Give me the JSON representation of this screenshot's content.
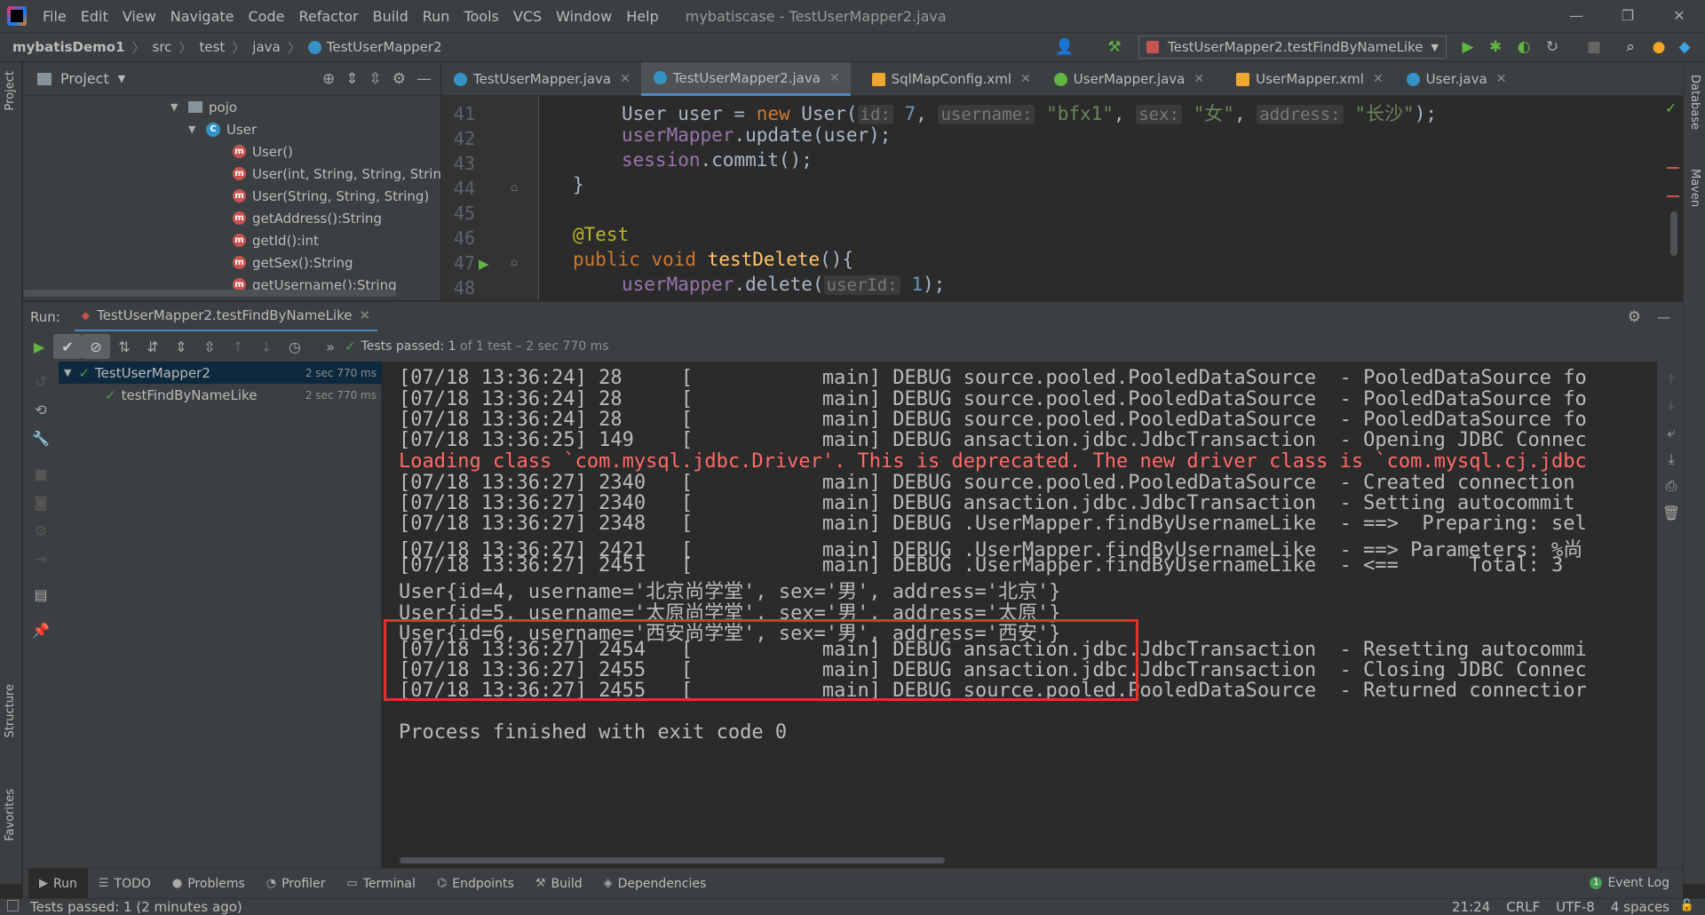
{
  "menubar": {
    "items": [
      "File",
      "Edit",
      "View",
      "Navigate",
      "Code",
      "Refactor",
      "Build",
      "Run",
      "Tools",
      "VCS",
      "Window",
      "Help"
    ],
    "window_title": "mybatiscase - TestUserMapper2.java",
    "minimize": "—",
    "maximize": "❐",
    "close": "✕"
  },
  "navbar": {
    "project": "mybatisDemo1",
    "crumbs": [
      "src",
      "test",
      "java"
    ],
    "file": "TestUserMapper2",
    "run_config": "TestUserMapper2.testFindByNameLike"
  },
  "project_panel": {
    "title": "Project",
    "tree": [
      {
        "label": "pojo",
        "kind": "package"
      },
      {
        "label": "User",
        "kind": "class"
      },
      {
        "label": "User()",
        "kind": "method"
      },
      {
        "label": "User(int, String, String, String",
        "kind": "method"
      },
      {
        "label": "User(String, String, String)",
        "kind": "method"
      },
      {
        "label": "getAddress():String",
        "kind": "method"
      },
      {
        "label": "getId():int",
        "kind": "method"
      },
      {
        "label": "getSex():String",
        "kind": "method"
      },
      {
        "label": "getUsername():String",
        "kind": "method"
      }
    ]
  },
  "tabs": [
    {
      "label": "TestUserMapper.java",
      "icon": "class"
    },
    {
      "label": "TestUserMapper2.java",
      "icon": "class"
    },
    {
      "label": "SqlMapConfig.xml",
      "icon": "xml"
    },
    {
      "label": "UserMapper.java",
      "icon": "interface"
    },
    {
      "label": "UserMapper.xml",
      "icon": "xml"
    },
    {
      "label": "User.java",
      "icon": "class"
    }
  ],
  "editor": {
    "line_numbers": [
      "41",
      "42",
      "43",
      "44",
      "45",
      "46",
      "47",
      "48"
    ],
    "line41": {
      "a": "User user = ",
      "kw": "new",
      "b": " User(",
      "h1": "id:",
      "n1": "7",
      "h2": "username:",
      "s1": "\"bfx1\"",
      "h3": "sex:",
      "s2": "\"女\"",
      "h4": "address:",
      "s3": "\"长沙\"",
      "end": ");"
    },
    "line42": {
      "f": "userMapper",
      "m": ".update(user);"
    },
    "line43": {
      "f": "session",
      "m": ".commit();"
    },
    "line44": "}",
    "line46": "@Test",
    "line47": {
      "kw": "public void ",
      "fn": "testDelete",
      "rest": "(){"
    },
    "line48": {
      "f": "userMapper",
      "m": ".delete(",
      "h": "userId:",
      "n": "1",
      "end": ");"
    }
  },
  "run": {
    "label": "Run:",
    "tab": "TestUserMapper2.testFindByNameLike",
    "status_prefix": "Tests passed:",
    "status_count": "1",
    "status_rest": "of 1 test – 2 sec 770 ms",
    "tree": [
      {
        "label": "TestUserMapper2",
        "time": "2 sec 770 ms"
      },
      {
        "label": "testFindByNameLike",
        "time": "2 sec 770 ms"
      }
    ],
    "console": [
      {
        "text": "[07/18 13:36:24] 28     [           main] DEBUG source.pooled.PooledDataSource  - PooledDataSource fo",
        "red": false
      },
      {
        "text": "[07/18 13:36:24] 28     [           main] DEBUG source.pooled.PooledDataSource  - PooledDataSource fo",
        "red": false
      },
      {
        "text": "[07/18 13:36:24] 28     [           main] DEBUG source.pooled.PooledDataSource  - PooledDataSource fo",
        "red": false
      },
      {
        "text": "[07/18 13:36:25] 149    [           main] DEBUG ansaction.jdbc.JdbcTransaction  - Opening JDBC Connec",
        "red": false
      },
      {
        "text": "Loading class `com.mysql.jdbc.Driver'. This is deprecated. The new driver class is `com.mysql.cj.jdbc",
        "red": true
      },
      {
        "text": "[07/18 13:36:27] 2340   [           main] DEBUG source.pooled.PooledDataSource  - Created connection",
        "red": false
      },
      {
        "text": "[07/18 13:36:27] 2340   [           main] DEBUG ansaction.jdbc.JdbcTransaction  - Setting autocommit",
        "red": false
      },
      {
        "text": "[07/18 13:36:27] 2348   [           main] DEBUG .UserMapper.findByUsernameLike  - ==>  Preparing: sel",
        "red": false
      },
      {
        "text": "[07/18 13:36:27] 2421   [           main] DEBUG .UserMapper.findByUsernameLike  - ==> Parameters: %尚",
        "red": false
      },
      {
        "text": "[07/18 13:36:27] 2451   [           main] DEBUG .UserMapper.findByUsernameLike  - <==      Total: 3",
        "red": false
      },
      {
        "text": "User{id=4, username='北京尚学堂', sex='男', address='北京'}",
        "red": false
      },
      {
        "text": "User{id=5, username='太原尚学堂', sex='男', address='太原'}",
        "red": false
      },
      {
        "text": "User{id=6, username='西安尚学堂', sex='男', address='西安'}",
        "red": false
      },
      {
        "text": "[07/18 13:36:27] 2454   [           main] DEBUG ansaction.jdbc.JdbcTransaction  - Resetting autocommi",
        "red": false
      },
      {
        "text": "[07/18 13:36:27] 2455   [           main] DEBUG ansaction.jdbc.JdbcTransaction  - Closing JDBC Connec",
        "red": false
      },
      {
        "text": "[07/18 13:36:27] 2455   [           main] DEBUG source.pooled.PooledDataSource  - Returned connectior",
        "red": false
      },
      {
        "text": "",
        "red": false
      },
      {
        "text": "Process finished with exit code 0",
        "red": false
      }
    ]
  },
  "left_stripe": {
    "project": "Project",
    "structure": "Structure",
    "favorites": "Favorites"
  },
  "right_stripe": {
    "database": "Database",
    "maven": "Maven"
  },
  "bottom_tools": [
    "Run",
    "TODO",
    "Problems",
    "Profiler",
    "Terminal",
    "Endpoints",
    "Build",
    "Dependencies"
  ],
  "event_log": "Event Log",
  "status": {
    "message": "Tests passed: 1 (2 minutes ago)",
    "position": "21:24",
    "line_sep": "CRLF",
    "encoding": "UTF-8",
    "indent": "4 spaces"
  },
  "colors": {
    "accent": "#4a88c7",
    "highlight_box": "#e0322f",
    "pass_green": "#499c54",
    "error_red": "#ff6b68"
  }
}
